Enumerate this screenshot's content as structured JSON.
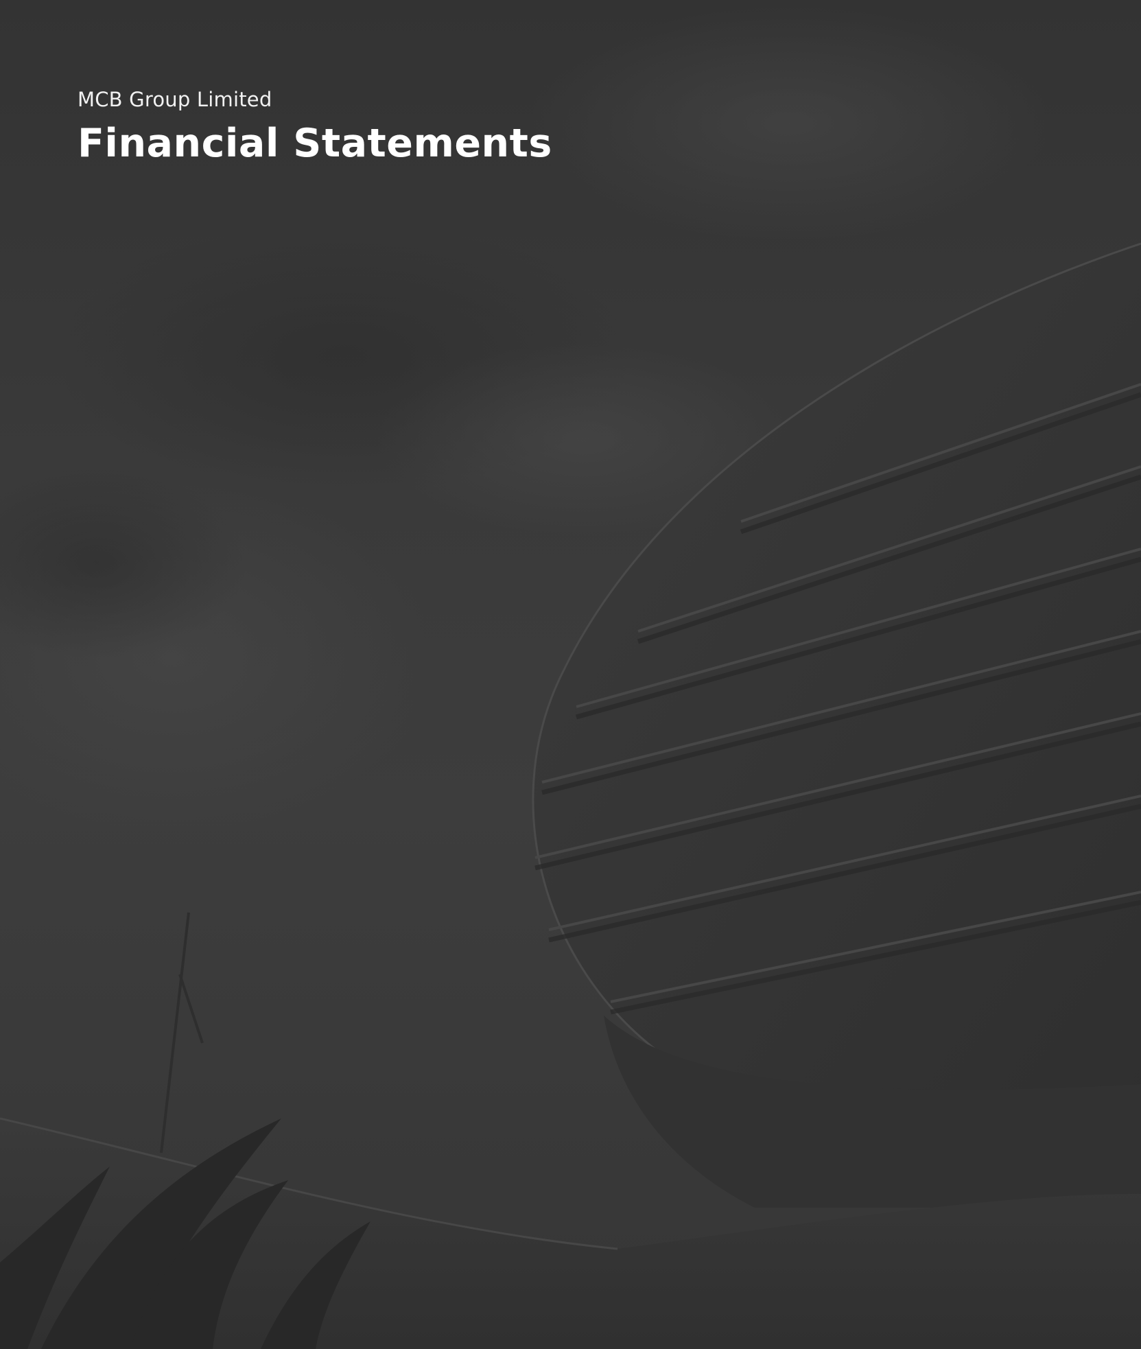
{
  "document": {
    "company_name": "MCB Group Limited",
    "title": "Financial Statements"
  },
  "colors": {
    "background": "#3a3a3a",
    "text": "#ffffff"
  }
}
